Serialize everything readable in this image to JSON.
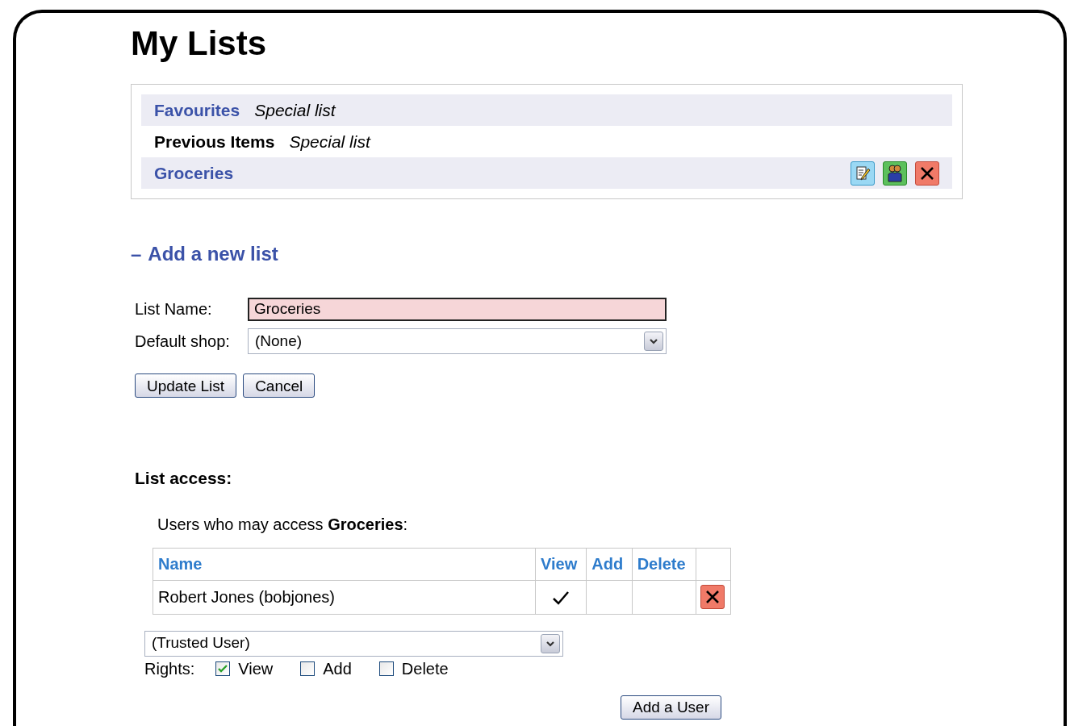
{
  "title": "My Lists",
  "lists": [
    {
      "name": "Favourites",
      "kind": "link",
      "note": "Special list",
      "actions": false
    },
    {
      "name": "Previous Items",
      "kind": "plain",
      "note": "Special list",
      "actions": false
    },
    {
      "name": "Groceries",
      "kind": "link",
      "actions": true
    }
  ],
  "new_list": {
    "toggle": "–",
    "heading": "Add a new list",
    "expanded": true,
    "fields": [
      {
        "kind": "text",
        "label": "List Name:",
        "value": "Groceries",
        "invalid": true
      },
      {
        "kind": "select",
        "label": "Default shop:",
        "value": "(None)"
      }
    ],
    "buttons": [
      "Update List",
      "Cancel"
    ]
  },
  "access": {
    "heading": "List access:",
    "intro": "Users who may access **Groceries**:",
    "table": {
      "columns": [
        "Name",
        "View",
        "Add",
        "Delete"
      ],
      "rows": [
        {
          "name": "Robert Jones (bobjones)",
          "view": true,
          "add": false,
          "delete": false
        }
      ]
    },
    "user_select": "(Trusted User)",
    "rights_label": "Rights:",
    "rights": [
      {
        "label": "View",
        "checked": true
      },
      {
        "label": "Add",
        "checked": false
      },
      {
        "label": "Delete",
        "checked": false
      }
    ],
    "add_button": "Add a User"
  }
}
